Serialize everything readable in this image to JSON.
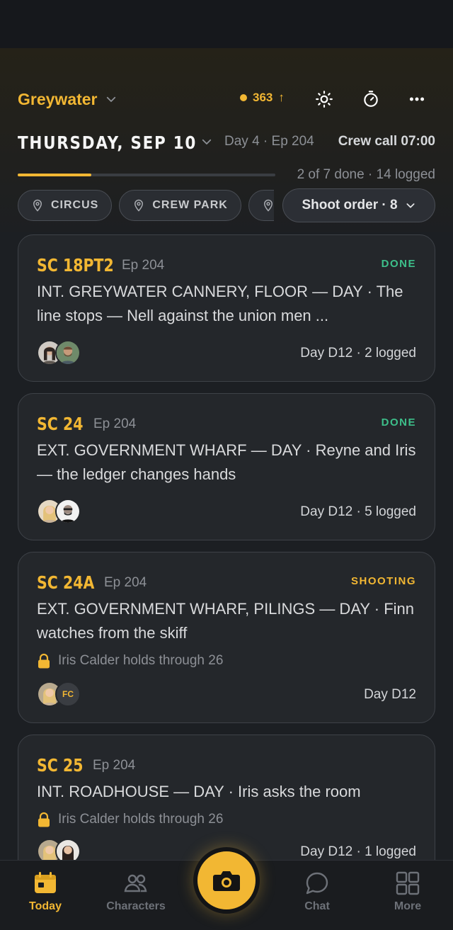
{
  "colors": {
    "accent": "#f2b733",
    "done": "#3dbf8a",
    "shooting": "#f2b733"
  },
  "header": {
    "project": "Greywater",
    "points": "363",
    "points_arrow": "↑",
    "icons": [
      "brightness-icon",
      "timer-icon",
      "more-icon"
    ]
  },
  "day": {
    "date": "THURSDAY, SEP 10",
    "day_ep": "Day 4 · Ep 204",
    "crew_call": "Crew call 07:00",
    "progress_text": "2 of 7 done · 14 logged",
    "progress_fraction": 0.2857
  },
  "filters": {
    "chips": [
      {
        "label": "CIRCUS"
      },
      {
        "label": "CREW PARK"
      },
      {
        "label": ""
      }
    ],
    "sort_label": "Shoot order · 8"
  },
  "scenes": [
    {
      "code": "SC 18PT2",
      "ep": "Ep 204",
      "status": "DONE",
      "status_color": "#3dbf8a",
      "desc": "INT. GREYWATER CANNERY, FLOOR — DAY · The line stops — Nell against the union men ...",
      "hold": "",
      "avatars": [
        "woman-dark-hair",
        "man-beard"
      ],
      "meta": "Day D12 · 2 logged"
    },
    {
      "code": "SC 24",
      "ep": "Ep 204",
      "status": "DONE",
      "status_color": "#3dbf8a",
      "desc": "EXT. GOVERNMENT WHARF — DAY · Reyne and Iris — the ledger changes hands",
      "hold": "",
      "avatars": [
        "woman-blonde",
        "man-glasses"
      ],
      "meta": "Day D12 · 5 logged"
    },
    {
      "code": "SC 24A",
      "ep": "Ep 204",
      "status": "SHOOTING",
      "status_color": "#f2b733",
      "desc": "EXT. GOVERNMENT WHARF, PILINGS — DAY · Finn watches from the skiff",
      "hold": "Iris Calder holds through 26",
      "avatars": [
        "woman-blonde"
      ],
      "initials": "FC",
      "meta": "Day D12"
    },
    {
      "code": "SC 25",
      "ep": "Ep 204",
      "status": "",
      "status_color": "#f2b733",
      "desc": "INT. ROADHOUSE — DAY · Iris asks the room",
      "hold": "Iris Calder holds through 26",
      "avatars": [
        "woman-blonde",
        "woman-dark-hair"
      ],
      "meta": "Day D12 · 1 logged"
    }
  ],
  "tabs": [
    {
      "label": "Today",
      "icon": "calendar-icon",
      "active": true
    },
    {
      "label": "Characters",
      "icon": "people-icon",
      "active": false
    },
    {
      "label": "Chat",
      "icon": "chat-icon",
      "active": false
    },
    {
      "label": "More",
      "icon": "grid-icon",
      "active": false
    }
  ],
  "camera_icon": "camera-icon"
}
